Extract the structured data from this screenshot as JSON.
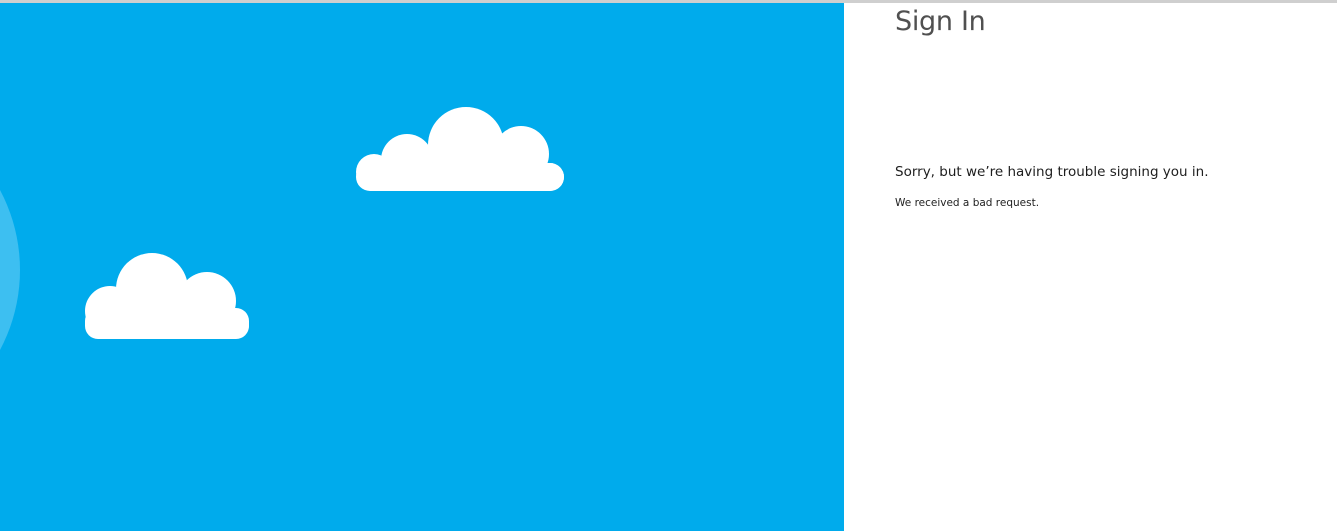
{
  "colors": {
    "sky_background": "#00ABEC",
    "cloud": "#FFFFFF",
    "sun_glow": "#3DBFF1",
    "top_border": "#CFCFCF"
  },
  "illustration": {
    "icons": [
      "cloud-icon",
      "cloud-icon",
      "sun-icon"
    ]
  },
  "form": {
    "title": "Sign In",
    "error_message": "Sorry, but we’re having trouble signing you in.",
    "error_detail": "We received a bad request."
  }
}
